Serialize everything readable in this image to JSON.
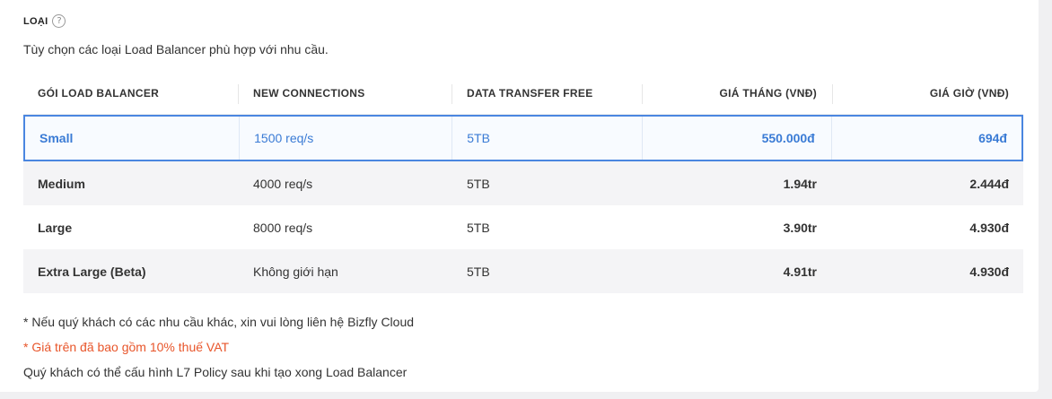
{
  "section": {
    "title": "LOẠI",
    "help_icon": "question-circle-icon",
    "subtitle": "Tùy chọn các loại Load Balancer phù hợp với nhu cầu."
  },
  "table": {
    "headers": [
      "GÓI LOAD BALANCER",
      "NEW CONNECTIONS",
      "DATA TRANSFER FREE",
      "GIÁ THÁNG (VNĐ)",
      "GIÁ GIỜ (VNĐ)"
    ],
    "rows": [
      {
        "name": "Small",
        "connections": "1500 req/s",
        "transfer": "5TB",
        "monthly": "550.000đ",
        "hourly": "694đ"
      },
      {
        "name": "Medium",
        "connections": "4000 req/s",
        "transfer": "5TB",
        "monthly": "1.94tr",
        "hourly": "2.444đ"
      },
      {
        "name": "Large",
        "connections": "8000 req/s",
        "transfer": "5TB",
        "monthly": "3.90tr",
        "hourly": "4.930đ"
      },
      {
        "name": "Extra Large (Beta)",
        "connections": "Không giới hạn",
        "transfer": "5TB",
        "monthly": "4.91tr",
        "hourly": "4.930đ"
      }
    ]
  },
  "notes": {
    "contact": "* Nếu quý khách có các nhu cầu khác, xin vui lòng liên hệ Bizfly Cloud",
    "vat": "* Giá trên đã bao gồm 10% thuế VAT",
    "policy": "Quý khách có thể cấu hình L7 Policy sau khi tạo xong Load Balancer"
  },
  "colors": {
    "accent": "#4a86e0",
    "warning": "#e8552a"
  }
}
